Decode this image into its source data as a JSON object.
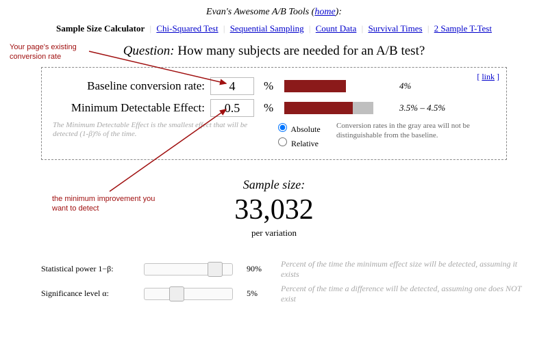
{
  "header": {
    "title": "Evan's Awesome A/B Tools",
    "home": "home"
  },
  "nav": {
    "current": "Sample Size Calculator",
    "items": [
      "Chi-Squared Test",
      "Sequential Sampling",
      "Count Data",
      "Survival Times",
      "2 Sample T-Test"
    ]
  },
  "question": {
    "label": "Question:",
    "text": "How many subjects are needed for an A/B test?"
  },
  "panel": {
    "link": "link",
    "baseline": {
      "label": "Baseline conversion rate:",
      "value": "4",
      "barlabel": "4%"
    },
    "mde": {
      "label": "Minimum Detectable Effect:",
      "value": "0.5",
      "barlabel": "3.5% – 4.5%"
    },
    "help": "The Minimum Detectable Effect is the smallest effect that will be detected (1-β)% of the time.",
    "absolute": "Absolute",
    "relative": "Relative",
    "graynote": "Conversion rates in the gray area will not be distinguishable from the baseline."
  },
  "result": {
    "label": "Sample size:",
    "value": "33,032",
    "per": "per variation"
  },
  "power": {
    "label": "Statistical power 1−β:",
    "value": "90%",
    "desc": "Percent of the time the minimum effect size will be detected, assuming it exists"
  },
  "alpha": {
    "label": "Significance level α:",
    "value": "5%",
    "desc": "Percent of the time a difference will be detected, assuming one does NOT exist"
  },
  "annotations": {
    "top": "Your page's existing conversion rate",
    "bottom": "the minimum improvement you want to detect"
  }
}
